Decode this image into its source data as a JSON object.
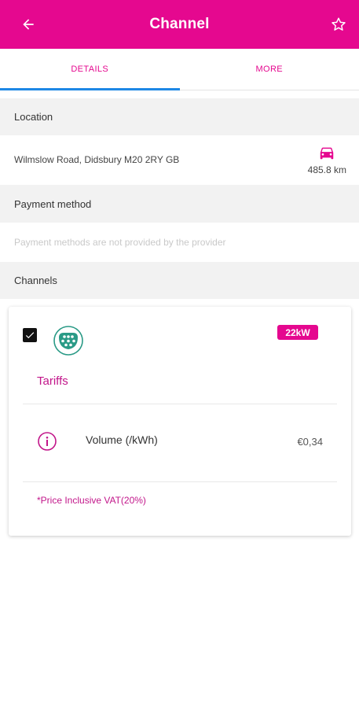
{
  "appbar": {
    "title": "Channel",
    "back_icon": "arrow-left-icon",
    "favorite_icon": "star-outline-icon",
    "color": "#e5088f"
  },
  "tabs": [
    {
      "label": "DETAILS",
      "active": true
    },
    {
      "label": "MORE",
      "active": false
    }
  ],
  "location": {
    "header": "Location",
    "address": "Wilmslow Road, Didsbury M20 2RY GB",
    "distance": "485.8 km",
    "icon": "car-icon"
  },
  "payment": {
    "header": "Payment method",
    "text": "Payment methods are not provided by the provider"
  },
  "channels": {
    "header": "Channels",
    "card": {
      "checked": true,
      "connector_icon": "type2-connector-icon",
      "power": "22kW",
      "tariffs_title": "Tariffs",
      "tariff": {
        "icon": "info-icon",
        "label": "Volume (/kWh)",
        "price": "€0,34"
      },
      "vat_note": "*Price Inclusive VAT(20%)"
    }
  }
}
